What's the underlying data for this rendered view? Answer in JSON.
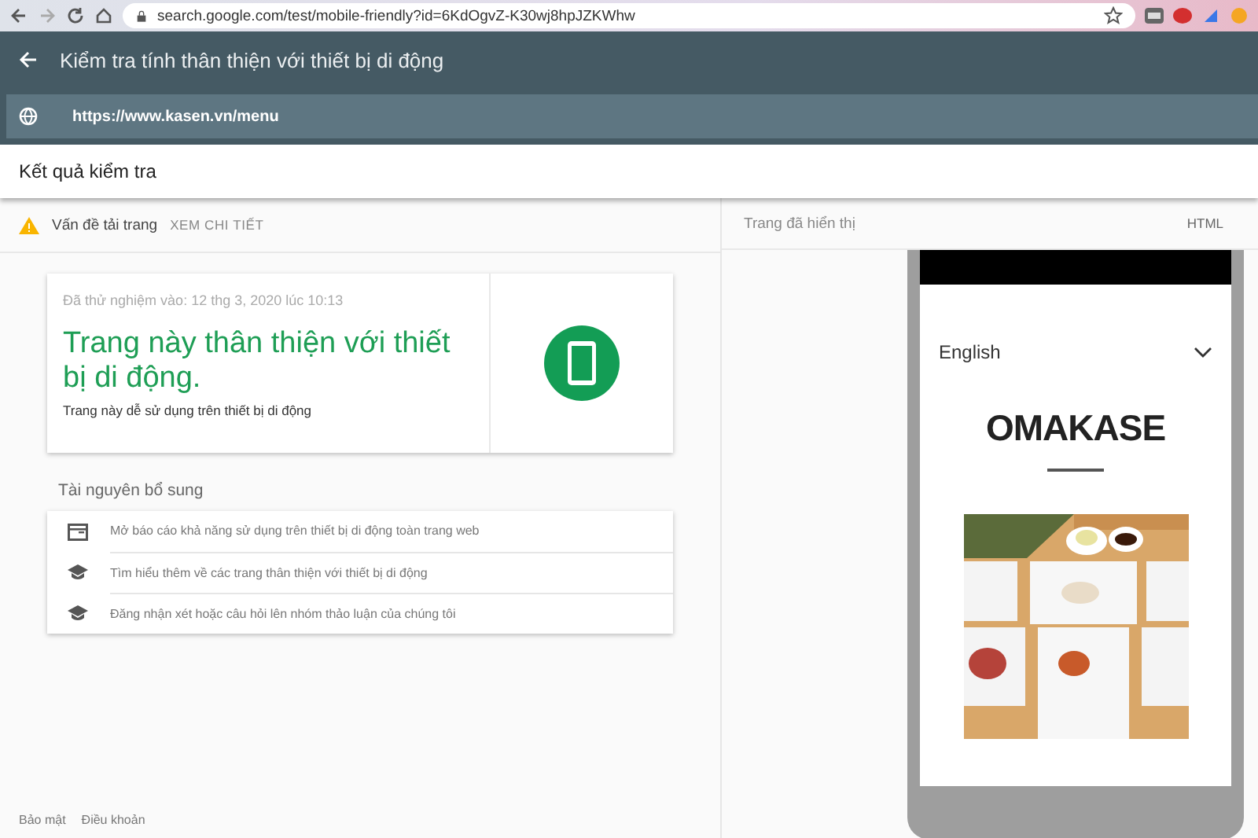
{
  "browser": {
    "url": "search.google.com/test/mobile-friendly?id=6KdOgvZ-K30wj8hpJZKWhw"
  },
  "app_bar": {
    "title": "Kiểm tra tính thân thiện với thiết bị di động"
  },
  "url_field": {
    "value": "https://www.kasen.vn/menu"
  },
  "results_header": {
    "title": "Kết quả kiểm tra"
  },
  "issues": {
    "label": "Vấn đề tải trang",
    "action": "XEM CHI TIẾT"
  },
  "result_card": {
    "tested_at": "Đã thử nghiệm vào: 12 thg 3, 2020 lúc 10:13",
    "headline": "Trang này thân thiện với thiết bị di động.",
    "description": "Trang này dễ sử dụng trên thiết bị di động"
  },
  "resources": {
    "title": "Tài nguyên bổ sung",
    "items": [
      {
        "kind": "report",
        "label": "Mở báo cáo khả năng sử dụng trên thiết bị di động toàn trang web"
      },
      {
        "kind": "learn",
        "label": "Tìm hiểu thêm về các trang thân thiện với thiết bị di động"
      },
      {
        "kind": "learn",
        "label": "Đăng nhận xét hoặc câu hỏi lên nhóm thảo luận của chúng tôi"
      }
    ]
  },
  "footer": {
    "links": [
      "Bảo mật",
      "Điều khoản"
    ]
  },
  "preview": {
    "title": "Trang đã hiển thị",
    "html_tab": "HTML",
    "page": {
      "language": "English",
      "heading": "OMAKASE"
    }
  }
}
